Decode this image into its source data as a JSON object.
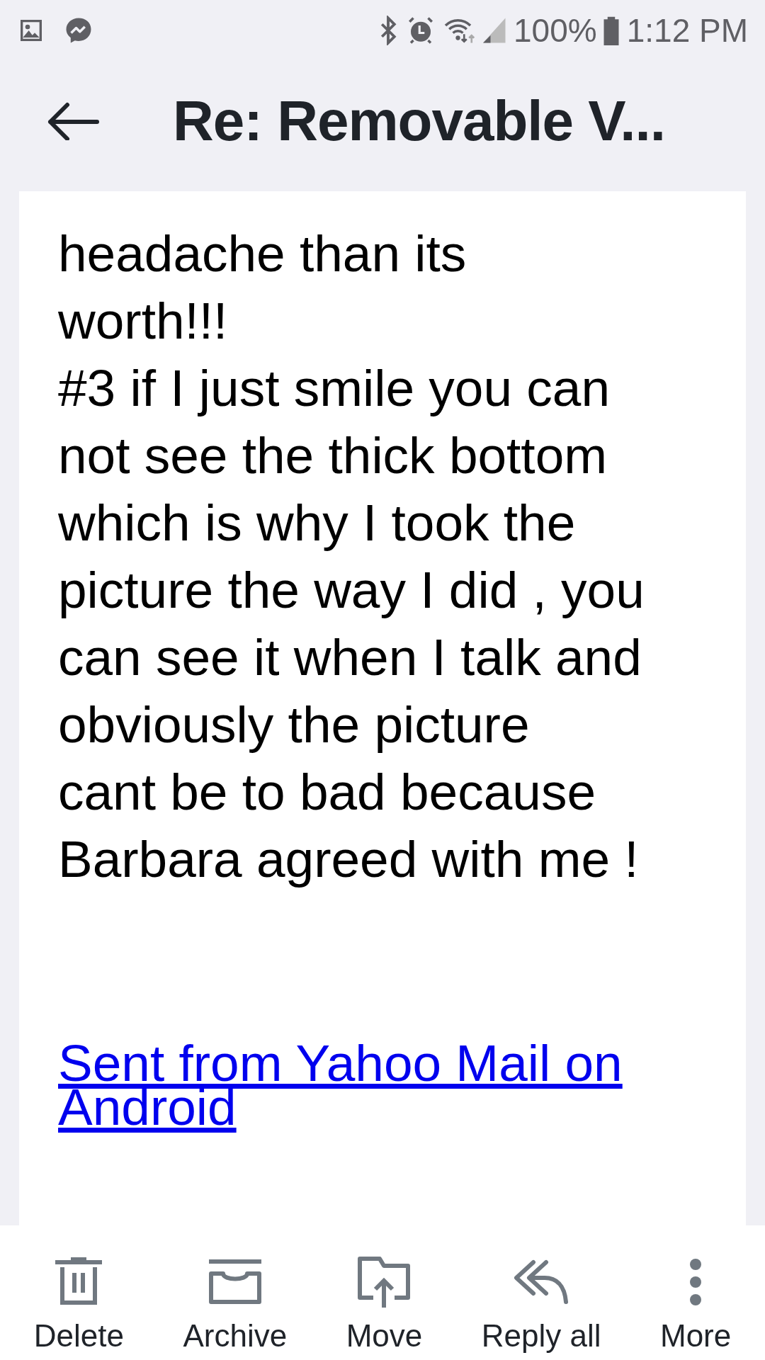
{
  "status_bar": {
    "battery": "100%",
    "time": "1:12 PM"
  },
  "header": {
    "title": "Re: Removable V..."
  },
  "message": {
    "body_lines": [
      "headache than its",
      "worth!!!",
      "#3 if I just smile you can",
      "not see the thick bottom",
      "which is why I took the",
      "picture the way I did , you",
      "can see it when I talk and",
      "obviously the picture",
      "cant be to bad because",
      "Barbara agreed with me !"
    ],
    "signature_link": "Sent from Yahoo Mail on Android"
  },
  "toolbar": [
    {
      "kind": "delete",
      "label": "Delete"
    },
    {
      "kind": "archive",
      "label": "Archive"
    },
    {
      "kind": "move",
      "label": "Move"
    },
    {
      "kind": "reply_all",
      "label": "Reply all"
    },
    {
      "kind": "more",
      "label": "More"
    }
  ]
}
